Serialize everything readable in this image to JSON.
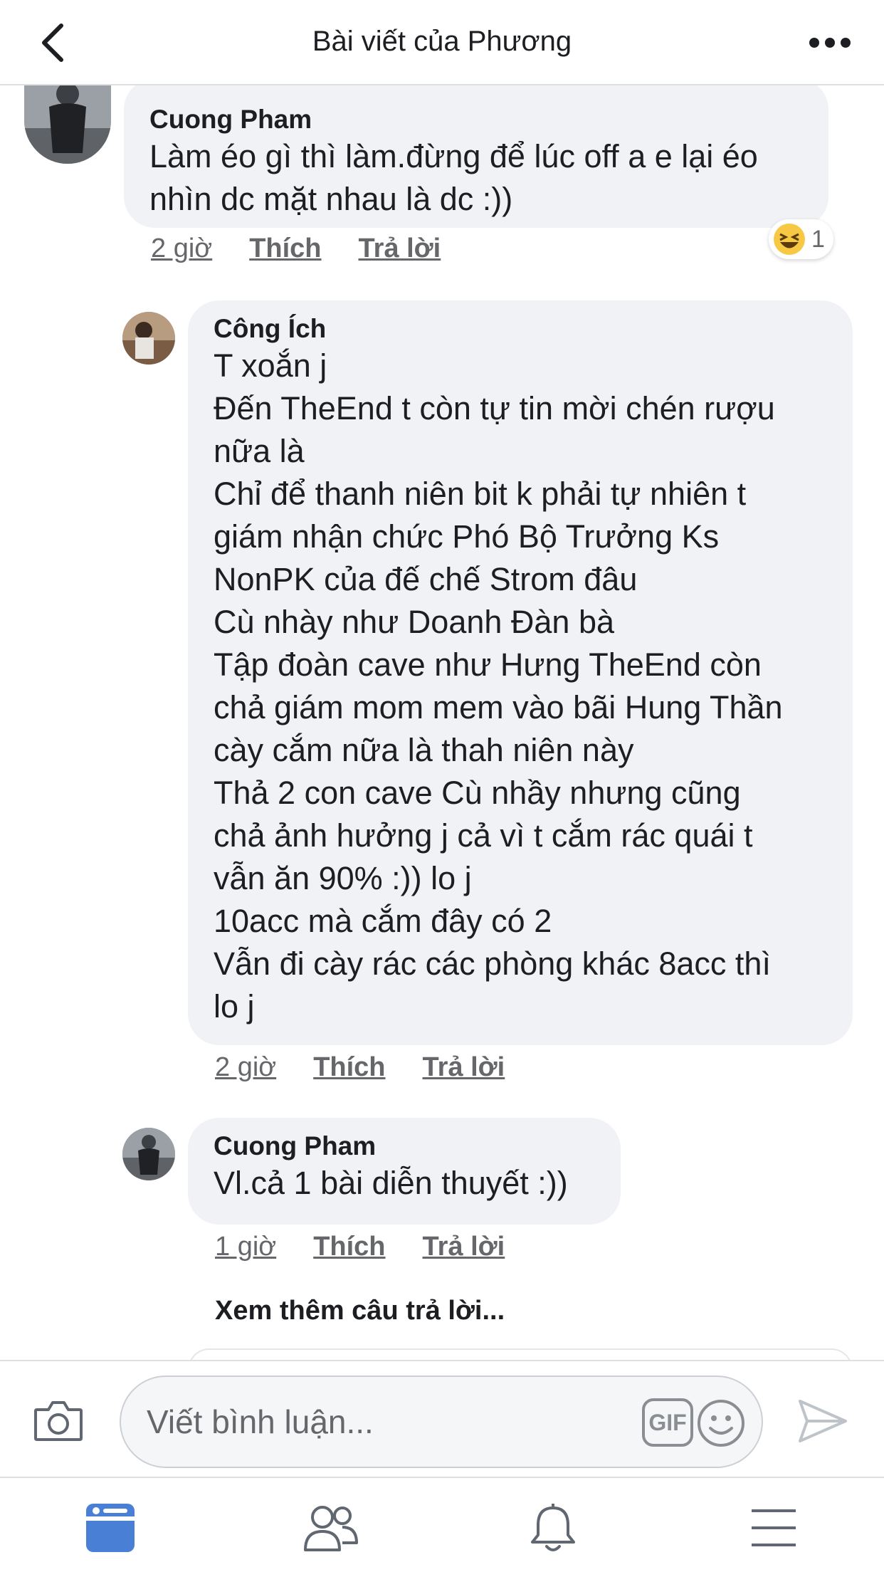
{
  "header": {
    "title": "Bài viết của Phương"
  },
  "comments": [
    {
      "author": "Cuong Pham",
      "text": "Làm éo gì thì làm.đừng để lúc off a e lại éo\nnhìn dc mặt nhau là dc :))",
      "time": "2 giờ",
      "like": "Thích",
      "reply": "Trả lời",
      "reaction_count": "1"
    },
    {
      "author": "Công Ích",
      "text": "T xoắn j\nĐến TheEnd t còn tự tin mời chén rượu\nnữa là\nChỉ để thanh niên bit k phải tự nhiên t\ngiám nhận chức Phó Bộ Trưởng Ks\nNonPK của đế chế Strom đâu\nCù nhày như Doanh Đàn bà\nTập đoàn cave như Hưng TheEnd còn\nchả giám mom mem vào bãi Hung Thần\ncày cắm nữa là thah niên này\nThả 2 con cave Cù nhầy nhưng cũng\nchả ảnh hưởng j cả vì t cắm rác quái t\nvẫn ăn 90% :)) lo j\n10acc mà cắm đây có 2\nVẫn đi cày rác các phòng khác 8acc thì\nlo j",
      "time": "2 giờ",
      "like": "Thích",
      "reply": "Trả lời"
    },
    {
      "author": "Cuong Pham",
      "text": "Vl.cả 1 bài diễn thuyết :))",
      "time": "1 giờ",
      "like": "Thích",
      "reply": "Trả lời"
    }
  ],
  "more_replies": "Xem thêm câu trả lời...",
  "composer": {
    "placeholder": "Viết bình luận...",
    "gif_label": "GIF"
  },
  "icons": {
    "back": "chevron-left-icon",
    "more": "more-horizontal-icon",
    "camera": "camera-icon",
    "emoji": "emoji-icon",
    "send": "send-icon",
    "reaction": "haha-reaction-icon",
    "tabs": [
      "news-feed-icon",
      "friends-icon",
      "notifications-icon",
      "menu-icon"
    ]
  },
  "colors": {
    "accent": "#4a7fd6",
    "bubble": "#f0f2f5",
    "meta_text": "#65676b"
  }
}
